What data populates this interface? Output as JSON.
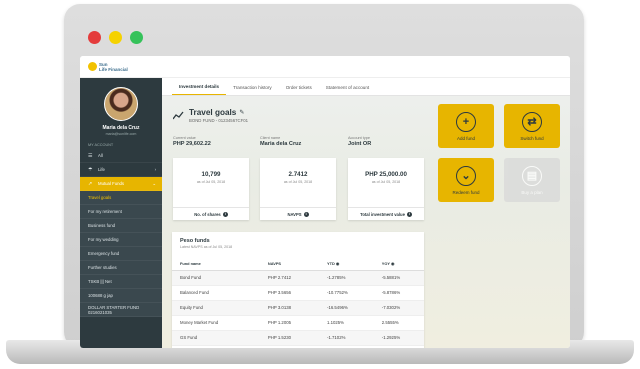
{
  "colors": {
    "accent": "#e7b500",
    "sidebar": "#2d3a3f",
    "dot_red": "#e43c3c",
    "dot_yellow": "#f5d200",
    "dot_green": "#35c25a"
  },
  "logo": {
    "line1": "Sun",
    "line2": "Life Financial"
  },
  "user": {
    "name": "Maria dela Cruz",
    "email": "maria@sunlife.com"
  },
  "sidebar": {
    "account_heading": "MY ACCOUNT",
    "items": [
      {
        "label": "All",
        "icon": "list-icon",
        "state": "normal"
      },
      {
        "label": "Life",
        "icon": "umbrella-icon",
        "state": "normal",
        "caret": "›"
      },
      {
        "label": "Mutual Funds",
        "icon": "chart-icon",
        "state": "active",
        "caret": "⌄"
      },
      {
        "label": "Travel goals",
        "state": "subhl"
      },
      {
        "label": "For my retirement",
        "state": "sub"
      },
      {
        "label": "Business fund",
        "state": "sub"
      },
      {
        "label": "For my wedding",
        "state": "sub"
      },
      {
        "label": "Emergency fund",
        "state": "sub"
      },
      {
        "label": "Further studies",
        "state": "sub"
      },
      {
        "label": "TSKB ||| Net",
        "state": "sub"
      },
      {
        "label": "100688 g jap",
        "state": "sub"
      },
      {
        "label": "DOLLAR STARTER FUND 0216021035",
        "state": "sub"
      }
    ]
  },
  "tabs": [
    {
      "label": "Investment details",
      "active": true
    },
    {
      "label": "Transaction history",
      "active": false
    },
    {
      "label": "Order tickets",
      "active": false
    },
    {
      "label": "Statement of account",
      "active": false
    }
  ],
  "header": {
    "title": "Travel goals",
    "subtitle": "BOND FUND - 01234567CF01"
  },
  "info": {
    "current_value_label": "Current value",
    "current_value": "PHP 29,602.22",
    "client_label": "Client name",
    "client_value": "Maria dela Cruz",
    "account_type_label": "Account type",
    "account_type_value": "Joint OR"
  },
  "cards": [
    {
      "value": "10,799",
      "date": "as of Jul 05, 2018",
      "footer": "No. of shares"
    },
    {
      "value": "2.7412",
      "date": "as of Jul 05, 2018",
      "footer": "NAVPS"
    },
    {
      "value": "PHP 25,000.00",
      "date": "as of Jul 05, 2018",
      "footer": "Total investment value"
    }
  ],
  "actions": [
    {
      "label": "Add fund",
      "icon": "plus-icon",
      "symbol": "+",
      "enabled": true
    },
    {
      "label": "Switch fund",
      "icon": "switch-icon",
      "symbol": "⇄",
      "enabled": true
    },
    {
      "label": "Redeem fund",
      "icon": "chevron-down-icon",
      "symbol": "⌄",
      "enabled": true
    },
    {
      "label": "Buy a plan",
      "icon": "document-icon",
      "symbol": "▤",
      "enabled": false
    }
  ],
  "peso_funds": {
    "title": "Peso funds",
    "subtitle": "Latest NAVPS as of Jul 05, 2018",
    "columns": [
      "Fund name",
      "NAVPS",
      "YTD",
      "YOY"
    ],
    "rows": [
      [
        "Bond Fund",
        "PHP 2.7412",
        "-1.2785%",
        "-5.5881%"
      ],
      [
        "Balanced Fund",
        "PHP 3.5656",
        "-10.7752%",
        "-5.8786%"
      ],
      [
        "Equity Fund",
        "PHP 3.0138",
        "-16.5496%",
        "-7.0302%"
      ],
      [
        "Money Market Fund",
        "PHP 1.2005",
        "1.1025%",
        "2.5555%"
      ],
      [
        "GS Fund",
        "PHP 1.5230",
        "-1.7102%",
        "-1.2925%"
      ]
    ]
  }
}
